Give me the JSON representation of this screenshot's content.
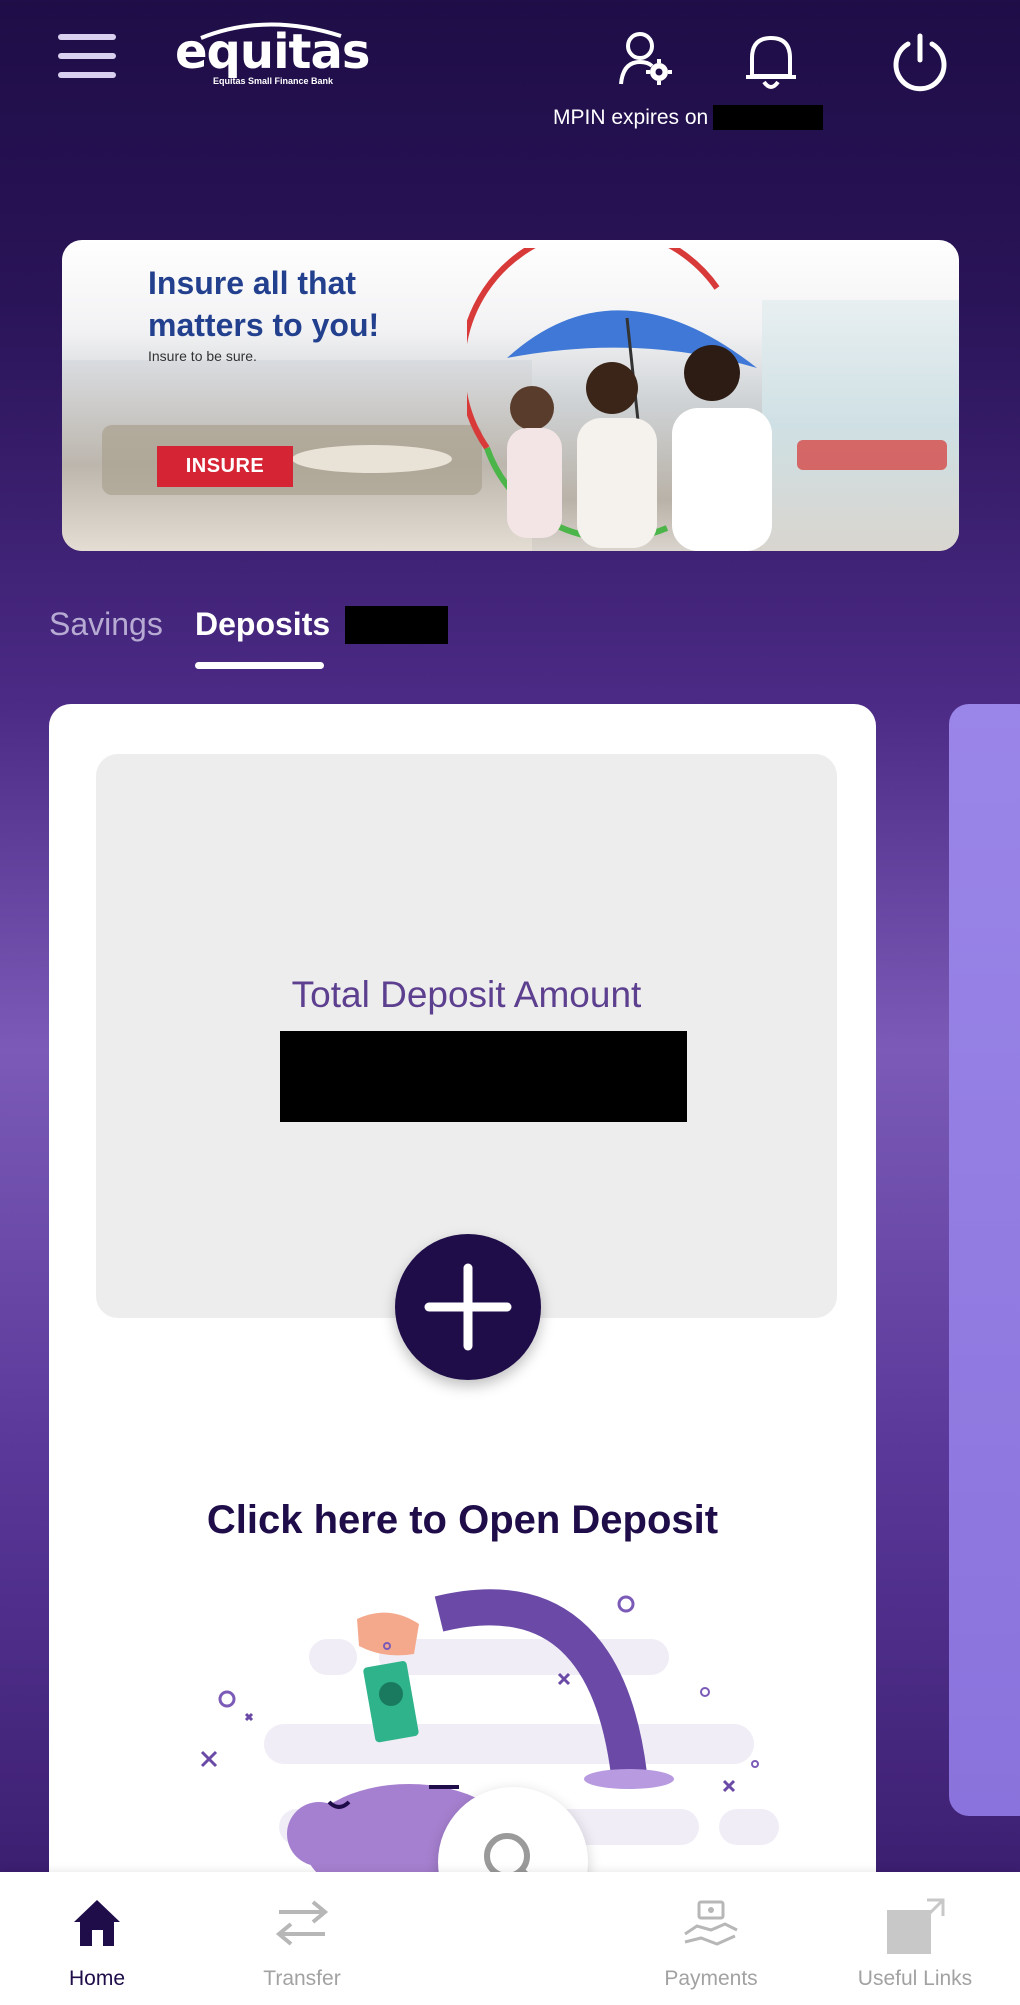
{
  "header": {
    "logo_text": "equitas",
    "logo_tagline": "Equitas Small Finance Bank",
    "mpin_text": "MPIN expires on",
    "icons": [
      "menu-icon",
      "profile-settings-icon",
      "bell-icon",
      "power-icon"
    ]
  },
  "banner": {
    "title": "Insure all that matters to you!",
    "subtitle": "Insure to be sure.",
    "button_label": "INSURE"
  },
  "tabs": [
    {
      "label": "Savings",
      "active": false
    },
    {
      "label": "Deposits",
      "active": true
    }
  ],
  "deposit_card": {
    "total_label": "Total Deposit Amount",
    "open_label": "Click here to Open Deposit"
  },
  "bottom_nav": [
    {
      "label": "Home",
      "icon": "home-icon",
      "active": true
    },
    {
      "label": "Transfer",
      "icon": "transfer-icon",
      "active": false
    },
    {
      "label": "Payments",
      "icon": "payments-icon",
      "active": false
    },
    {
      "label": "Useful Links",
      "icon": "external-link-icon",
      "active": false
    }
  ],
  "colors": {
    "primary_dark": "#1f0d4a",
    "accent_purple": "#5d3f8f",
    "banner_red": "#d52534",
    "inactive_gray": "#a2a2a2"
  }
}
